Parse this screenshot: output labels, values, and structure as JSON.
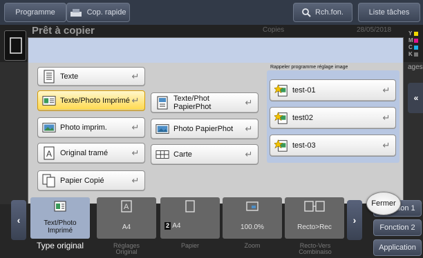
{
  "topbar": {
    "programme": "Programme",
    "cop_rapide": "Cop. rapide",
    "search": "Rch.fon.",
    "liste_taches": "Liste tâches"
  },
  "status": {
    "ready": "Prêt à copier",
    "copies": "Copies",
    "date": "28/05/2018",
    "cmyk": [
      "Y",
      "M",
      "C",
      "K"
    ],
    "ages": "ages",
    "cmyk_colors": [
      "#f0d800",
      "#e0148c",
      "#1fb0e8",
      "#222222"
    ]
  },
  "dialog": {
    "recall_title": "Rappeler programme réglage image",
    "col1": [
      {
        "label": "Texte",
        "icon": "text-doc-icon"
      },
      {
        "label": "Texte/Photo Imprimé",
        "icon": "text-photo-icon",
        "selected": true
      },
      {
        "label": "Photo imprim.",
        "icon": "photo-print-icon"
      },
      {
        "label": "Original tramé",
        "icon": "dotted-original-icon"
      },
      {
        "label": "Papier Copié",
        "icon": "copied-paper-icon"
      }
    ],
    "col2": [
      {
        "label": "Texte/Phot PapierPhot",
        "icon": "text-photopaper-icon"
      },
      {
        "label": "Photo PapierPhot",
        "icon": "photo-paper-icon"
      },
      {
        "label": "Carte",
        "icon": "map-icon"
      }
    ],
    "programs": [
      {
        "label": "test-01"
      },
      {
        "label": "test02"
      },
      {
        "label": "test-03"
      }
    ],
    "close": "Fermer"
  },
  "bottom": {
    "cards": [
      {
        "value": "Text/Photo Imprimé",
        "caption": "Type original"
      },
      {
        "value": "A4",
        "caption": "Réglages Original"
      },
      {
        "value": "A4",
        "badge": "2",
        "caption": "Papier"
      },
      {
        "value": "100.0%",
        "caption": "Zoom"
      },
      {
        "value": "Recto>Rec",
        "caption": "Recto-Vers Combinaiso"
      }
    ],
    "functions": [
      "Fonction 1",
      "Fonction 2",
      "Application"
    ]
  }
}
